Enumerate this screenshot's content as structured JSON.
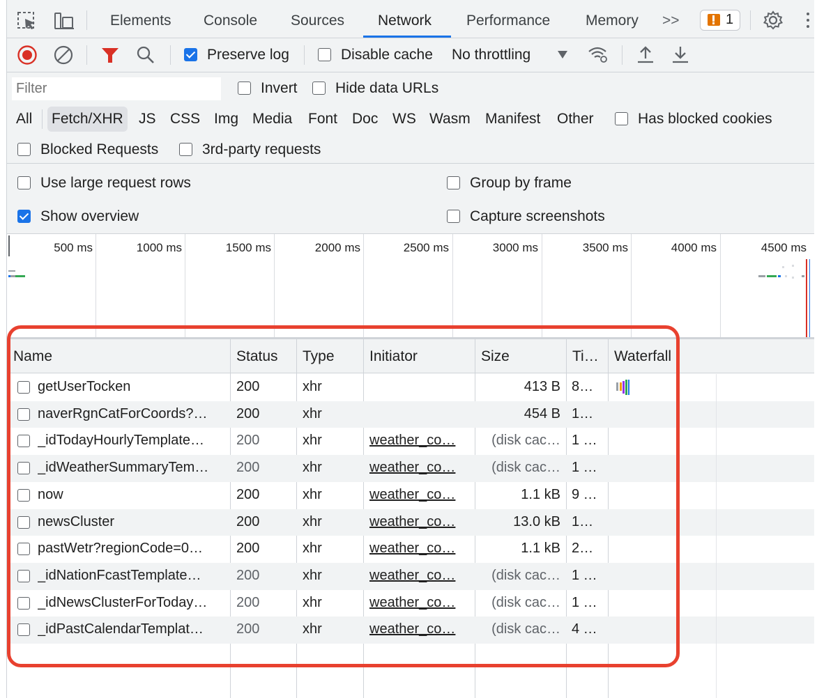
{
  "toolbar": {
    "tabs": [
      "Elements",
      "Console",
      "Sources",
      "Network",
      "Performance",
      "Memory"
    ],
    "active_tab": "Network",
    "more_tabs_label": ">>",
    "issues_count": "1"
  },
  "network_bar": {
    "preserve_log": {
      "label": "Preserve log",
      "checked": true
    },
    "disable_cache": {
      "label": "Disable cache",
      "checked": false
    },
    "throttling": "No throttling"
  },
  "filter": {
    "placeholder": "Filter",
    "invert": "Invert",
    "hide_data_urls": "Hide data URLs",
    "types": [
      "All",
      "Fetch/XHR",
      "JS",
      "CSS",
      "Img",
      "Media",
      "Font",
      "Doc",
      "WS",
      "Wasm",
      "Manifest",
      "Other"
    ],
    "selected_type": "Fetch/XHR",
    "has_blocked_cookies": "Has blocked cookies",
    "blocked_requests": "Blocked Requests",
    "third_party": "3rd-party requests"
  },
  "settings": {
    "large_rows": "Use large request rows",
    "group_by_frame": "Group by frame",
    "show_overview": {
      "label": "Show overview",
      "checked": true
    },
    "capture_screenshots": "Capture screenshots"
  },
  "overview": {
    "ticks": [
      "500 ms",
      "1000 ms",
      "1500 ms",
      "2000 ms",
      "2500 ms",
      "3000 ms",
      "3500 ms",
      "4000 ms",
      "4500 ms"
    ]
  },
  "table": {
    "columns": [
      "Name",
      "Status",
      "Type",
      "Initiator",
      "Size",
      "Ti…",
      "Waterfall"
    ],
    "rows": [
      {
        "name": "getUserTocken",
        "status": "200",
        "type": "xhr",
        "initiator": "",
        "size": "413 B",
        "time": "8…",
        "grey": false
      },
      {
        "name": "naverRgnCatForCoords?…",
        "status": "200",
        "type": "xhr",
        "initiator": "",
        "size": "454 B",
        "time": "1…",
        "grey": false
      },
      {
        "name": "_idTodayHourlyTemplate…",
        "status": "200",
        "type": "xhr",
        "initiator": "weather_co…",
        "size": "(disk cac…",
        "time": "1 …",
        "grey": true
      },
      {
        "name": "_idWeatherSummaryTem…",
        "status": "200",
        "type": "xhr",
        "initiator": "weather_co…",
        "size": "(disk cac…",
        "time": "1 …",
        "grey": true
      },
      {
        "name": "now",
        "status": "200",
        "type": "xhr",
        "initiator": "weather_co…",
        "size": "1.1 kB",
        "time": "9 …",
        "grey": false
      },
      {
        "name": "newsCluster",
        "status": "200",
        "type": "xhr",
        "initiator": "weather_co…",
        "size": "13.0 kB",
        "time": "1…",
        "grey": false
      },
      {
        "name": "pastWetr?regionCode=0…",
        "status": "200",
        "type": "xhr",
        "initiator": "weather_co…",
        "size": "1.1 kB",
        "time": "2…",
        "grey": false
      },
      {
        "name": "_idNationFcastTemplate…",
        "status": "200",
        "type": "xhr",
        "initiator": "weather_co…",
        "size": "(disk cac…",
        "time": "1 …",
        "grey": true
      },
      {
        "name": "_idNewsClusterForToday…",
        "status": "200",
        "type": "xhr",
        "initiator": "weather_co…",
        "size": "(disk cac…",
        "time": "1 …",
        "grey": true
      },
      {
        "name": "_idPastCalendarTemplat…",
        "status": "200",
        "type": "xhr",
        "initiator": "weather_co…",
        "size": "(disk cac…",
        "time": "4 …",
        "grey": true
      }
    ]
  },
  "colors": {
    "accent": "#1a73e8",
    "record": "#d93025",
    "filter_icon": "#d93025",
    "highlight": "#e8412f",
    "issue_badge": "#e37400"
  }
}
